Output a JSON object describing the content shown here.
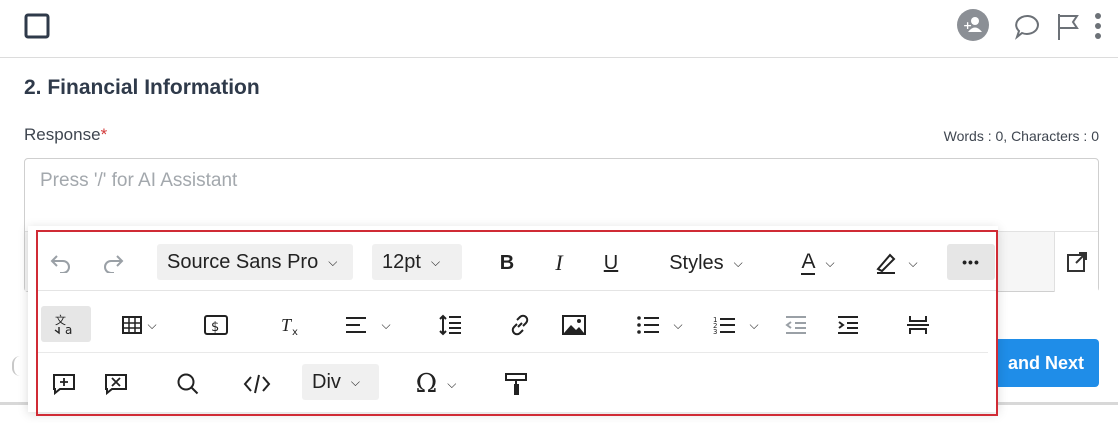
{
  "section": {
    "title": "2. Financial Information"
  },
  "response": {
    "label": "Response",
    "required_mark": "*"
  },
  "counter": "Words : 0, Characters : 0",
  "editor": {
    "placeholder": "Press '/' for AI Assistant"
  },
  "toolbar": {
    "font_family": "Source Sans Pro",
    "font_size": "12pt",
    "styles_label": "Styles",
    "bold": "B",
    "italic": "I",
    "underline": "U",
    "text_color_glyph": "A",
    "more": "•••",
    "block_format": "Div",
    "special_char": "Ω",
    "chev": "⌄"
  },
  "save_next_label": "and Next",
  "colors": {
    "accent": "#1f8de8",
    "highlight": "#d02b35"
  }
}
